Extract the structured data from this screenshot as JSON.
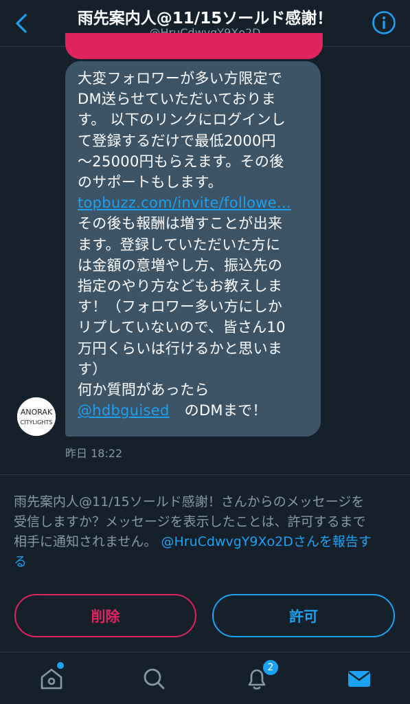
{
  "header": {
    "title": "雨先案内人@11/15ソールド感謝！",
    "handle": "@HruCdwvgY9Xo2D"
  },
  "message": {
    "lines": [
      "大変フォロワーが多い方限定で",
      "DM送らせていただいておりま",
      "す。 以下のリンクにログインし",
      "て登録するだけで最低2000円",
      "〜25000円もらえます。その後",
      "のサポートもします。"
    ],
    "link": "topbuzz.com/invite/followe...",
    "lines2": [
      "その後も報酬は増すことが出来",
      "ます。登録していただいた方に",
      "は金額の意増やし方、振込先の",
      "指定のやり方などもお教えしま",
      "す！（フォロワー多い方にしか",
      "リプしていないので、皆さん10",
      "万円くらいは行けるかと思いま",
      "す）",
      "何か質問があったら"
    ],
    "mention": "@hdbguised",
    "mention_suffix": "のDMまで！",
    "timestamp": "昨日 18:22"
  },
  "avatar": {
    "line1": "ANORAK",
    "line2": "CITYLIGHTS"
  },
  "notice": {
    "line1": "雨先案内人@11/15ソールド感謝！さんからのメッセージを",
    "line2": "受信しますか？メッセージを表示したことは、許可するまで",
    "line3_prefix": "相手に通知されません。",
    "line3_link": "@HruCdwvgY9Xo2Dさんを報告す",
    "line4_link": "る"
  },
  "buttons": {
    "delete": "削除",
    "allow": "許可"
  },
  "tabbar": {
    "notification_count": "2",
    "icons": [
      "home-icon",
      "search-icon",
      "bell-icon",
      "mail-icon"
    ]
  },
  "colors": {
    "background": "#15202b",
    "bubble": "#3d5466",
    "accent": "#1da1f2",
    "danger": "#e0245e",
    "muted": "#8899a6"
  }
}
